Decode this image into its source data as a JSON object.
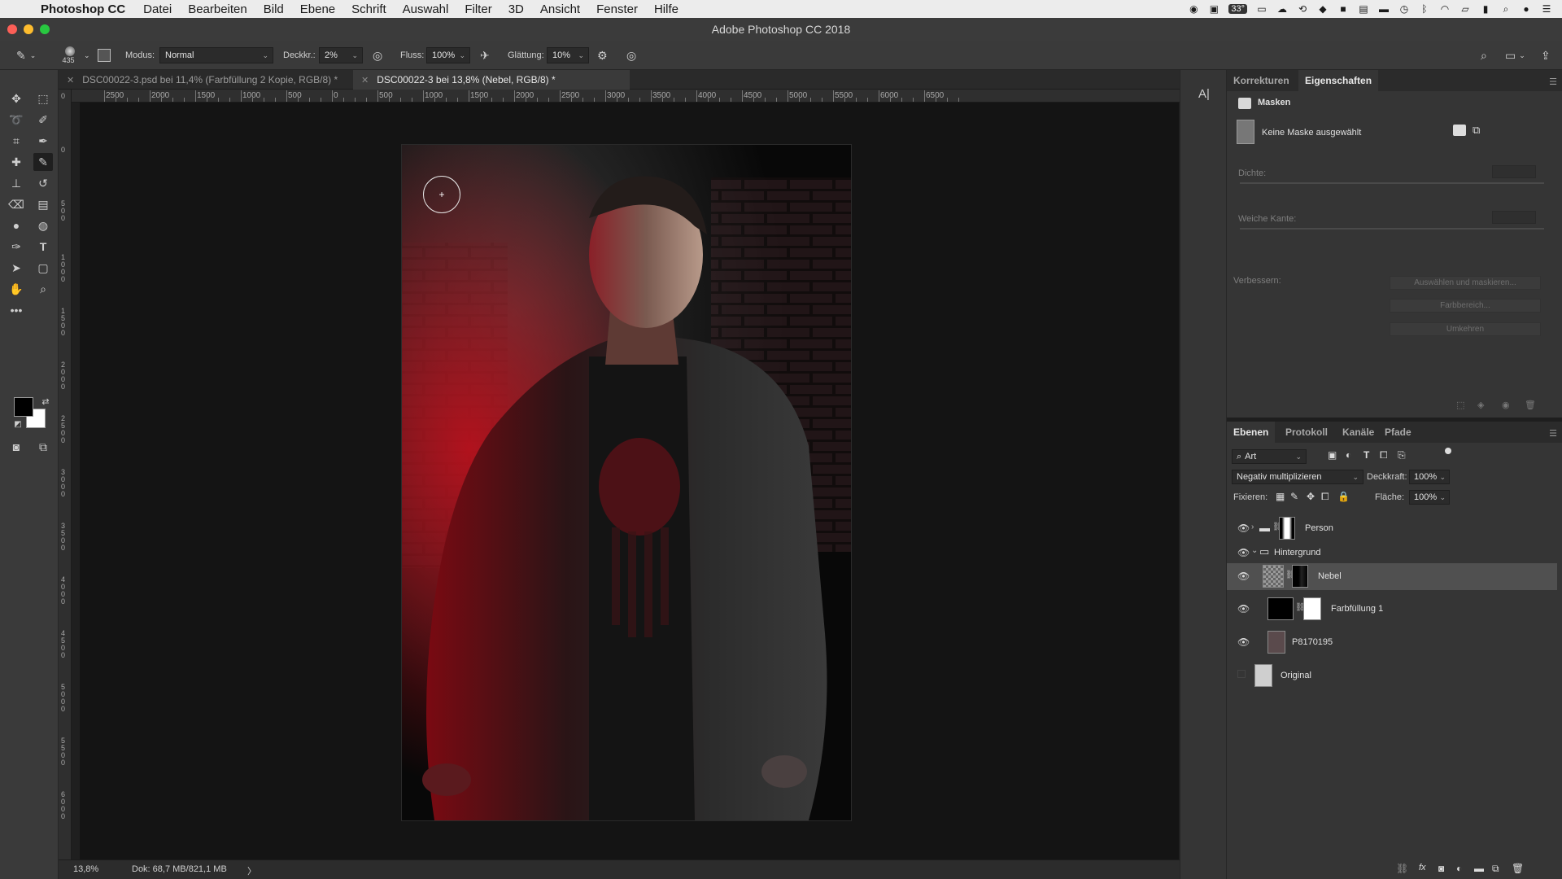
{
  "menubar": {
    "app_name": "Photoshop CC",
    "items": [
      "Datei",
      "Bearbeiten",
      "Bild",
      "Ebene",
      "Schrift",
      "Auswahl",
      "Filter",
      "3D",
      "Ansicht",
      "Fenster",
      "Hilfe"
    ],
    "temperature": "33°"
  },
  "window": {
    "title": "Adobe Photoshop CC 2018"
  },
  "options": {
    "brush_size": "435",
    "mode_label": "Modus:",
    "mode_value": "Normal",
    "opacity_label": "Deckkr.:",
    "opacity_value": "2%",
    "flow_label": "Fluss:",
    "flow_value": "100%",
    "smoothing_label": "Glättung:",
    "smoothing_value": "10%"
  },
  "tabs": [
    {
      "label": "DSC00022-3.psd bei 11,4% (Farbfüllung 2 Kopie, RGB/8) *",
      "active": false
    },
    {
      "label": "DSC00022-3 bei 13,8% (Nebel, RGB/8) *",
      "active": true
    }
  ],
  "ruler_h": [
    "2500",
    "2000",
    "1500",
    "1000",
    "500",
    "0",
    "500",
    "1000",
    "1500",
    "2000",
    "2500",
    "3000",
    "3500",
    "4000",
    "4500",
    "5000",
    "5500",
    "6000",
    "6500"
  ],
  "ruler_v": [
    "0",
    "0",
    "500",
    "1000",
    "1500",
    "2000",
    "2500",
    "3000",
    "3500",
    "4000",
    "4500",
    "5000",
    "5500",
    "6000"
  ],
  "status": {
    "zoom": "13,8%",
    "doc": "Dok: 68,7 MB/821,1 MB",
    "arrow": "〉"
  },
  "properties": {
    "tab_corrections": "Korrekturen",
    "tab_properties": "Eigenschaften",
    "section": "Masken",
    "mask_state": "Keine Maske ausgewählt",
    "density": "Dichte:",
    "feather": "Weiche Kante:",
    "refine": "Verbessern:",
    "btn_select_mask": "Auswählen und maskieren...",
    "btn_color_range": "Farbbereich...",
    "btn_invert": "Umkehren"
  },
  "layers_panel": {
    "tabs": [
      "Ebenen",
      "Protokoll",
      "Kanäle",
      "Pfade"
    ],
    "filter_kind": "Art",
    "blend_mode": "Negativ multiplizieren",
    "opacity_label": "Deckkraft:",
    "opacity_value": "100%",
    "lock_label": "Fixieren:",
    "fill_label": "Fläche:",
    "fill_value": "100%",
    "layers": [
      {
        "name": "Person",
        "visible": true,
        "type": "group"
      },
      {
        "name": "Hintergrund",
        "visible": true,
        "type": "group"
      },
      {
        "name": "Nebel",
        "visible": true,
        "type": "layer",
        "selected": true
      },
      {
        "name": "Farbfüllung 1",
        "visible": true,
        "type": "fill"
      },
      {
        "name": "P8170195",
        "visible": true,
        "type": "layer"
      },
      {
        "name": "Original",
        "visible": false,
        "type": "smart"
      }
    ]
  },
  "colors": {
    "accent_red": "#b3101c",
    "panel_bg": "#353535",
    "selection": "#505050"
  }
}
